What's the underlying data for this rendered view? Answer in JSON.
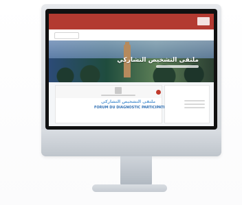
{
  "screen": {
    "header": {
      "logo_text": ""
    },
    "nav": {
      "items": [
        "",
        "",
        "",
        "",
        "",
        "",
        ""
      ]
    },
    "hero": {
      "title": "ملتقى التشخيص التشاركي"
    },
    "card": {
      "arabic_title": "ملتقى التشخيص التشاركي",
      "french_title": "FORUM DU DIAGNOSTIC PARTICIPATIF"
    }
  }
}
